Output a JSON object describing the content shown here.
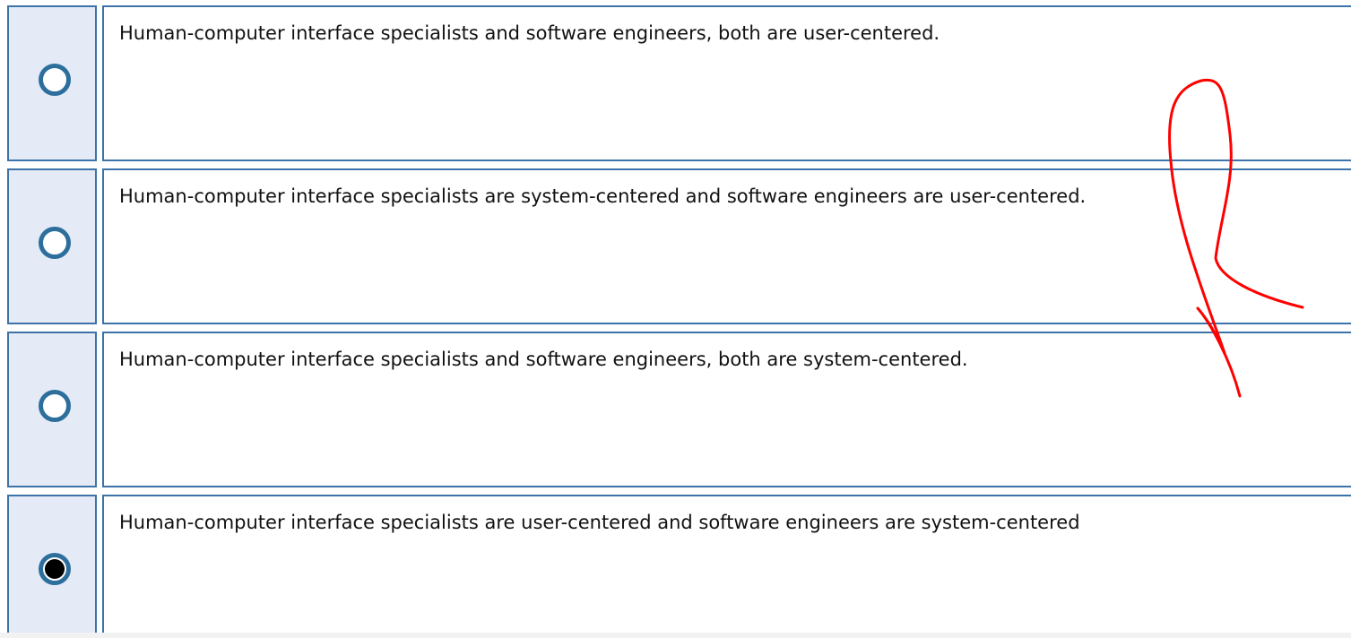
{
  "question": {
    "options": [
      {
        "label": "Human-computer interface specialists and software engineers, both are user-centered.",
        "selected": false
      },
      {
        "label": "Human-computer interface specialists are system-centered and software engineers are user-centered.",
        "selected": false
      },
      {
        "label": "Human-computer interface specialists and software engineers, both are system-centered.",
        "selected": false
      },
      {
        "label": "Human-computer interface specialists are user-centered and software engineers are system-centered",
        "selected": true
      }
    ]
  },
  "colors": {
    "radio_cell_bg": "#e4eaf6",
    "border": "#3c73a8",
    "radio_ring": "#2d6f9c",
    "annotation_ink": "#ff0000"
  },
  "annotation": {
    "kind": "handwritten red pen stroke"
  }
}
